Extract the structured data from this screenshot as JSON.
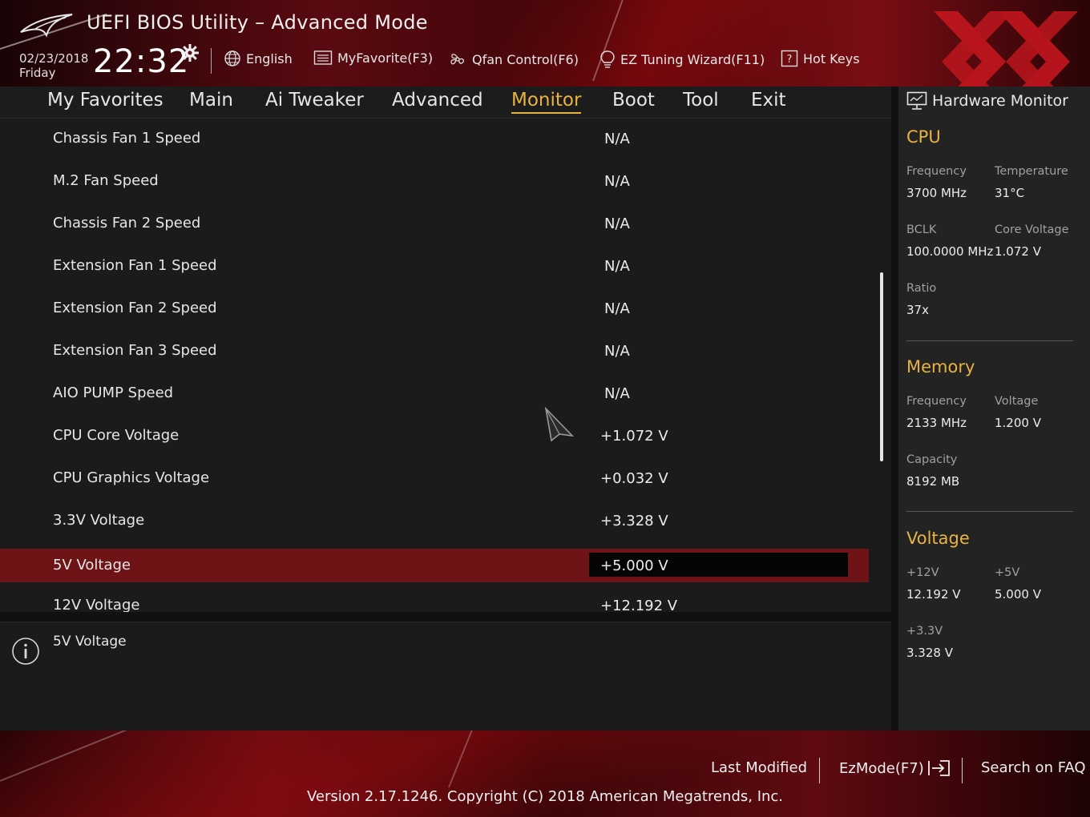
{
  "header": {
    "title": "UEFI BIOS Utility – Advanced Mode",
    "date": "02/23/2018",
    "day": "Friday",
    "time": "22:32",
    "toolbar": {
      "language": "English",
      "favorite": "MyFavorite(F3)",
      "qfan": "Qfan Control(F6)",
      "ez_tuning": "EZ Tuning Wizard(F11)",
      "hot_keys": "Hot Keys"
    }
  },
  "menu": {
    "items": [
      "My Favorites",
      "Main",
      "Ai Tweaker",
      "Advanced",
      "Monitor",
      "Boot",
      "Tool",
      "Exit"
    ],
    "active": "Monitor"
  },
  "monitor_list": {
    "rows": [
      {
        "label": "Chassis Fan 1 Speed",
        "value": "N/A"
      },
      {
        "label": "M.2 Fan Speed",
        "value": "N/A"
      },
      {
        "label": "Chassis Fan 2 Speed",
        "value": "N/A"
      },
      {
        "label": "Extension Fan 1 Speed",
        "value": "N/A"
      },
      {
        "label": "Extension Fan 2 Speed",
        "value": "N/A"
      },
      {
        "label": "Extension Fan 3 Speed",
        "value": "N/A"
      },
      {
        "label": "AIO PUMP Speed",
        "value": "N/A"
      },
      {
        "label": "CPU Core Voltage",
        "value": "+1.072 V"
      },
      {
        "label": "CPU Graphics Voltage",
        "value": "+0.032 V"
      },
      {
        "label": "3.3V Voltage",
        "value": "+3.328 V"
      },
      {
        "label": "5V Voltage",
        "value": "+5.000 V"
      },
      {
        "label": "12V Voltage",
        "value": "+12.192 V"
      }
    ],
    "selected": "5V Voltage"
  },
  "help": {
    "text": "5V Voltage"
  },
  "hardware_monitor": {
    "title": "Hardware Monitor",
    "cpu": {
      "title": "CPU",
      "frequency_label": "Frequency",
      "frequency": "3700 MHz",
      "temperature_label": "Temperature",
      "temperature": "31°C",
      "bclk_label": "BCLK",
      "bclk": "100.0000 MHz",
      "core_voltage_label": "Core Voltage",
      "core_voltage": "1.072 V",
      "ratio_label": "Ratio",
      "ratio": "37x"
    },
    "memory": {
      "title": "Memory",
      "frequency_label": "Frequency",
      "frequency": "2133 MHz",
      "voltage_label": "Voltage",
      "voltage": "1.200 V",
      "capacity_label": "Capacity",
      "capacity": "8192 MB"
    },
    "voltage": {
      "title": "Voltage",
      "v12_label": "+12V",
      "v12": "12.192 V",
      "v5_label": "+5V",
      "v5": "5.000 V",
      "v33_label": "+3.3V",
      "v33": "3.328 V"
    }
  },
  "footer": {
    "last_modified": "Last Modified",
    "ezmode": "EzMode(F7)",
    "search_faq": "Search on FAQ",
    "version": "Version 2.17.1246. Copyright (C) 2018 American Megatrends, Inc."
  },
  "colors": {
    "accent": "#e8b341",
    "selected_row": "#6e1416",
    "brand_red": "#c0161e"
  }
}
